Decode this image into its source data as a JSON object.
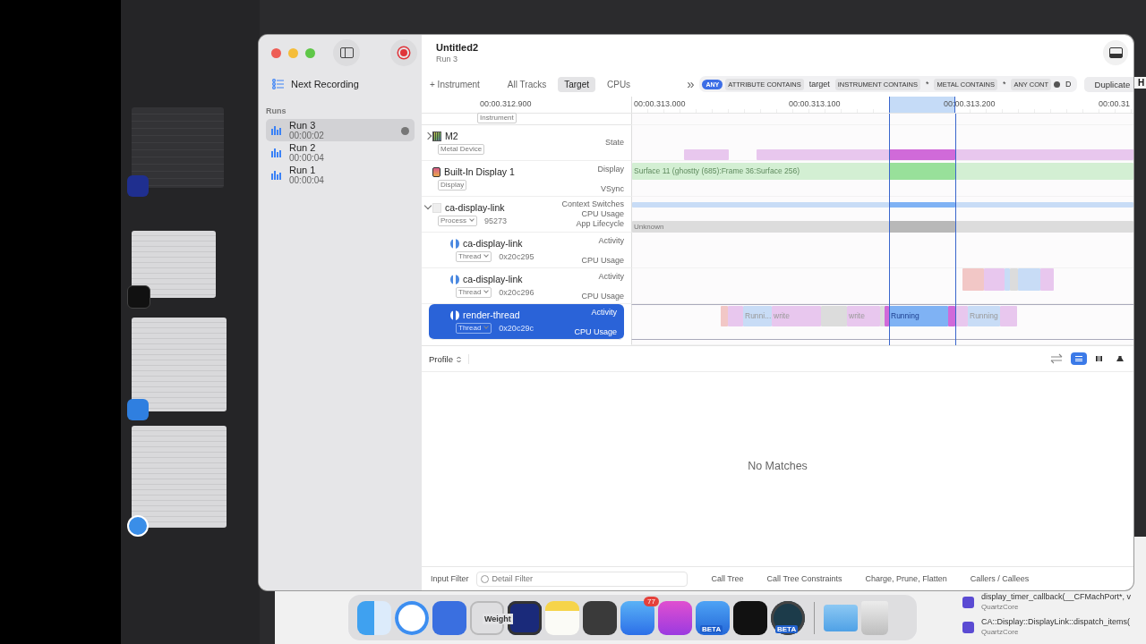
{
  "window": {
    "title": "Untitled2",
    "subtitle": "Run 3"
  },
  "sidebar": {
    "next_recording": "Next Recording",
    "section": "Runs",
    "runs": [
      {
        "name": "Run 3",
        "duration": "00:00:02",
        "selected": true
      },
      {
        "name": "Run 2",
        "duration": "00:00:04",
        "selected": false
      },
      {
        "name": "Run 1",
        "duration": "00:00:04",
        "selected": false
      }
    ]
  },
  "scope": {
    "add_instrument": "+ Instrument",
    "tabs": [
      {
        "label": "All Tracks",
        "selected": false
      },
      {
        "label": "Target",
        "selected": true
      },
      {
        "label": "CPUs",
        "selected": false
      }
    ],
    "overflow": "»"
  },
  "filter": {
    "mode": "ANY",
    "tokens": [
      {
        "kind": "menu",
        "label": "ATTRIBUTE CONTAINS"
      },
      {
        "kind": "value",
        "label": "target"
      },
      {
        "kind": "menu",
        "label": "INSTRUMENT CONTAINS"
      },
      {
        "kind": "value",
        "label": "*"
      },
      {
        "kind": "menu",
        "label": "METAL CONTAINS"
      },
      {
        "kind": "value",
        "label": "*"
      },
      {
        "kind": "cut",
        "label": "ANY CONT"
      },
      {
        "kind": "value",
        "label": "D"
      }
    ]
  },
  "duplicate_button": "Duplicate",
  "edge_text": "H",
  "ruler": {
    "ticks": [
      "00:00.312.900",
      "00:00.313.000",
      "00:00.313.100",
      "00:00.313.200",
      "00:00.31"
    ]
  },
  "tracks": [
    {
      "kind": "partial",
      "tag": "Instrument",
      "selected": false
    },
    {
      "kind": "device",
      "name": "M2",
      "tag": "Metal Device",
      "expanded": false,
      "selected": false,
      "lanes": [
        "State"
      ]
    },
    {
      "kind": "display",
      "name": "Built-In Display 1",
      "tag": "Display",
      "selected": false,
      "lanes": [
        "Display",
        "VSync"
      ],
      "band": "Surface 11 (ghostty (685):Frame 36:Surface 256)"
    },
    {
      "kind": "process",
      "name": "ca-display-link",
      "tag": "Process",
      "id": "95273",
      "expanded": true,
      "selected": false,
      "lanes": [
        "Context Switches",
        "CPU Usage",
        "App Lifecycle"
      ],
      "band": "Unknown"
    },
    {
      "kind": "thread",
      "name": "ca-display-link",
      "tag": "Thread",
      "id": "0x20c295",
      "selected": false,
      "lanes": [
        "Activity",
        "CPU Usage"
      ]
    },
    {
      "kind": "thread",
      "name": "ca-display-link",
      "tag": "Thread",
      "id": "0x20c296",
      "selected": false,
      "lanes": [
        "Activity",
        "CPU Usage"
      ]
    },
    {
      "kind": "thread",
      "name": "render-thread",
      "tag": "Thread",
      "id": "0x20c29c",
      "selected": true,
      "lanes": [
        "Activity",
        "CPU Usage"
      ],
      "segments": [
        "Runni...",
        "write",
        "write",
        "Running",
        "Running"
      ]
    }
  ],
  "detail": {
    "view_menu": "Profile",
    "empty_message": "No Matches",
    "view_modes": [
      {
        "kind": "list",
        "selected": true
      },
      {
        "kind": "bars",
        "selected": false
      },
      {
        "kind": "weight",
        "selected": false
      }
    ]
  },
  "bottom_bar": {
    "label": "Input Filter",
    "placeholder": "Detail Filter",
    "buttons": [
      "Call Tree",
      "Call Tree Constraints",
      "Charge, Prune, Flatten",
      "Callers / Callees"
    ]
  },
  "dock": {
    "background_text": "Weight",
    "items": [
      {
        "kind": "finder"
      },
      {
        "kind": "browser"
      },
      {
        "kind": "simulator"
      },
      {
        "kind": "blank"
      },
      {
        "kind": "terminal"
      },
      {
        "kind": "notes"
      },
      {
        "kind": "letter-app"
      },
      {
        "kind": "mail",
        "badge": "77"
      },
      {
        "kind": "star-app"
      },
      {
        "kind": "hammer",
        "label": "BETA"
      },
      {
        "kind": "monitor"
      },
      {
        "kind": "gauge",
        "label": "BETA"
      },
      {
        "kind": "folder"
      },
      {
        "kind": "trash"
      }
    ]
  },
  "back_window": {
    "rows": [
      {
        "symbol": "display_timer_callback(__CFMachPort*, v",
        "library": "QuartzCore"
      },
      {
        "symbol": "CA::Display::DisplayLink::dispatch_items(",
        "library": "QuartzCore"
      }
    ]
  }
}
